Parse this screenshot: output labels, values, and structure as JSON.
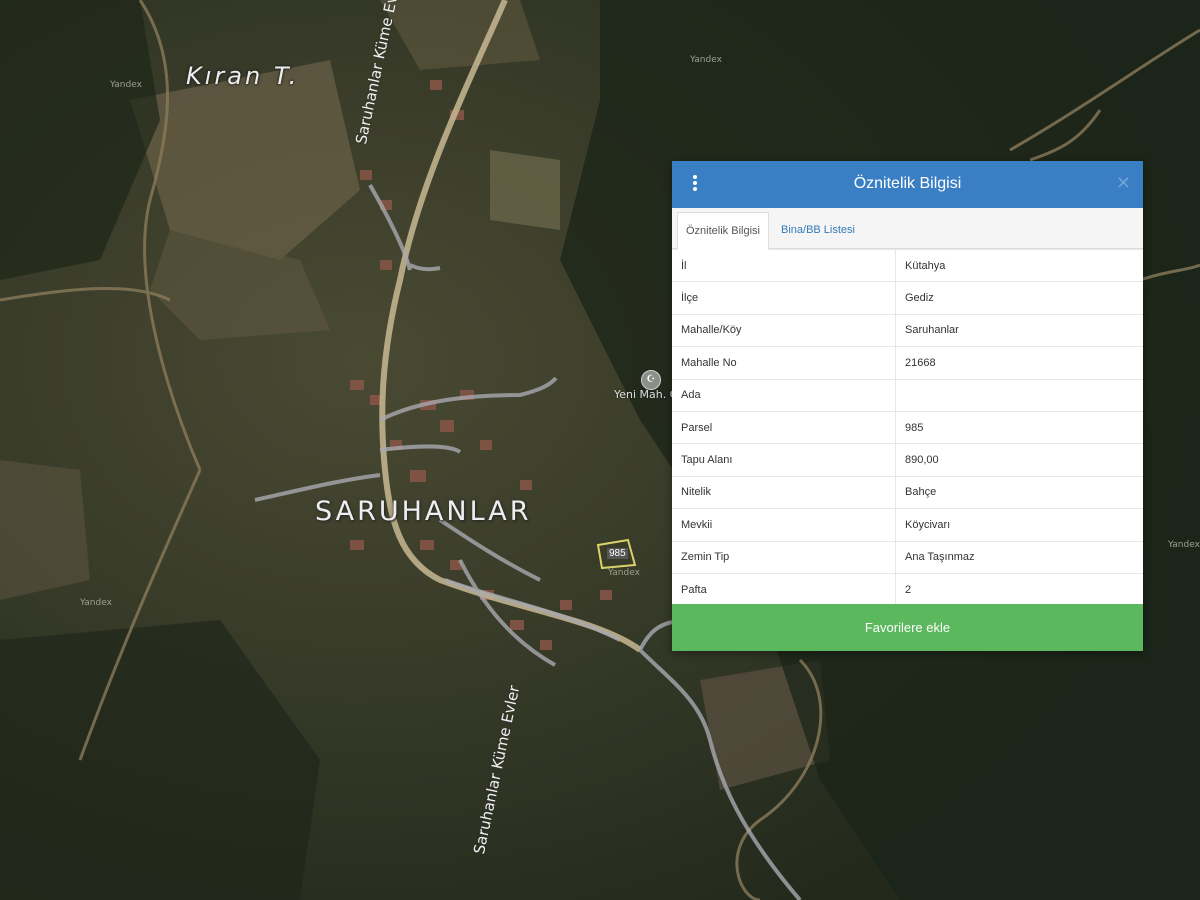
{
  "map": {
    "labels": {
      "hill": "Kıran T.",
      "village": "SARUHANLAR",
      "road_north": "Saruhanlar Küme Evler",
      "road_south": "Saruhanlar Küme Evler",
      "mosque": "Yeni Mah. C",
      "parcel": "985",
      "faint_1": "Yandex",
      "faint_2": "Yandex",
      "faint_3": "Yandex",
      "faint_4": "Yandex",
      "faint_5": "Yandex"
    },
    "colors": {
      "parcel_outline": "#d9d36a",
      "road": "#a9a9b0",
      "dirt_track": "#8a7a5a"
    }
  },
  "panel": {
    "title": "Öznitelik Bilgisi",
    "tabs": [
      {
        "label": "Öznitelik Bilgisi",
        "active": true
      },
      {
        "label": "Bina/BB Listesi",
        "active": false
      }
    ],
    "rows": [
      {
        "key": "İl",
        "value": "Kütahya"
      },
      {
        "key": "İlçe",
        "value": "Gediz"
      },
      {
        "key": "Mahalle/Köy",
        "value": "Saruhanlar"
      },
      {
        "key": "Mahalle No",
        "value": "21668"
      },
      {
        "key": "Ada",
        "value": ""
      },
      {
        "key": "Parsel",
        "value": "985"
      },
      {
        "key": "Tapu Alanı",
        "value": "890,00"
      },
      {
        "key": "Nitelik",
        "value": "Bahçe"
      },
      {
        "key": "Mevkii",
        "value": "Köycivarı"
      },
      {
        "key": "Zemin Tip",
        "value": "Ana Taşınmaz"
      },
      {
        "key": "Pafta",
        "value": "2"
      }
    ],
    "button_label": "Favorilere ekle",
    "colors": {
      "header": "#3a7fc4",
      "button": "#5cb85c",
      "tab_link": "#337ab7"
    }
  }
}
